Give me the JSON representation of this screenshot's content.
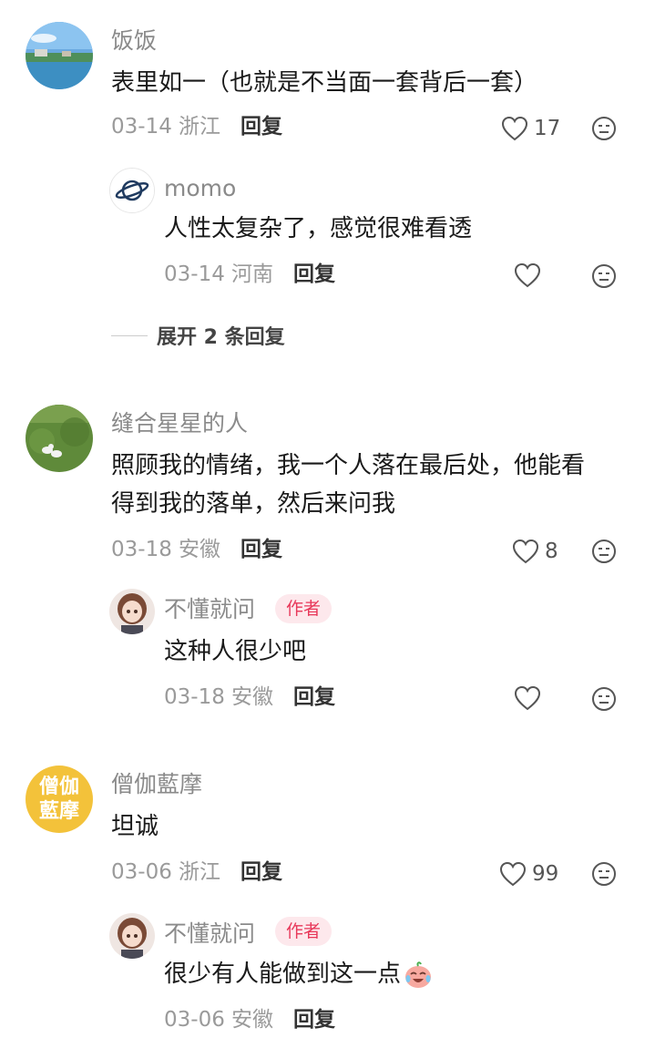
{
  "comments": [
    {
      "username": "饭饭",
      "text": "表里如一（也就是不当面一套背后一套）",
      "date": "03-14",
      "location": "浙江",
      "reply_label": "回复",
      "like_count": "17",
      "reply": {
        "username": "momo",
        "text": "人性太复杂了，感觉很难看透",
        "date": "03-14",
        "location": "河南",
        "reply_label": "回复"
      },
      "expand_label": "展开 2 条回复"
    },
    {
      "username": "缝合星星的人",
      "text_line1": "照顾我的情绪，我一个人落在最后处，他能看",
      "text_line2": "得到我的落单，然后来问我",
      "date": "03-18",
      "location": "安徽",
      "reply_label": "回复",
      "like_count": "8",
      "reply": {
        "username": "不懂就问",
        "badge": "作者",
        "text": "这种人很少吧",
        "date": "03-18",
        "location": "安徽",
        "reply_label": "回复"
      }
    },
    {
      "username": "僧伽藍摩",
      "avatar_text": "僧伽藍摩",
      "text": "坦诚",
      "date": "03-06",
      "location": "浙江",
      "reply_label": "回复",
      "like_count": "99",
      "reply": {
        "username": "不懂就问",
        "badge": "作者",
        "text": "很少有人能做到这一点",
        "date": "03-06",
        "location": "安徽",
        "reply_label": "回复"
      }
    }
  ],
  "colors": {
    "author_badge_bg": "#fde8ec",
    "author_badge_text": "#e8385a",
    "meta_text": "#9a9a9a",
    "username_text": "#8a8a8a"
  }
}
